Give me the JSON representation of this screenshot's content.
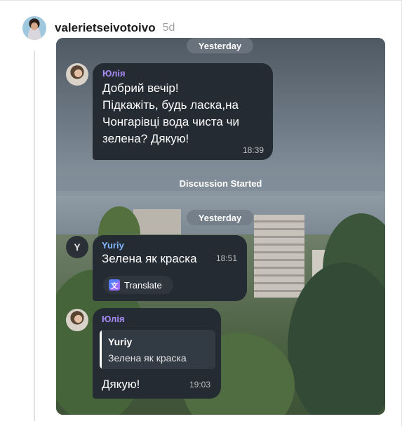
{
  "post": {
    "username": "valerietseivotoivo",
    "time_ago": "5d"
  },
  "chat": {
    "date_top": "Yesterday",
    "banner": "Discussion Started",
    "date_second": "Yesterday",
    "messages": [
      {
        "sender": "Юлія",
        "text": "Добрий вечір!\nПідкажіть, будь ласка,на\nЧонгарівці вода чиста чи\nзелена? Дякую!",
        "time": "18:39"
      },
      {
        "avatar_letter": "Y",
        "sender": "Yuriy",
        "text": "Зелена як краска",
        "time": "18:51",
        "translate_label": "Translate"
      },
      {
        "sender": "Юлія",
        "reply": {
          "name": "Yuriy",
          "text": "Зелена як краска"
        },
        "text": "Дякую!",
        "time": "19:03"
      }
    ]
  },
  "colors": {
    "sender_purple": "#a78bf5",
    "sender_blue": "#7fb5ff",
    "bubble_bg": "#252b32"
  }
}
